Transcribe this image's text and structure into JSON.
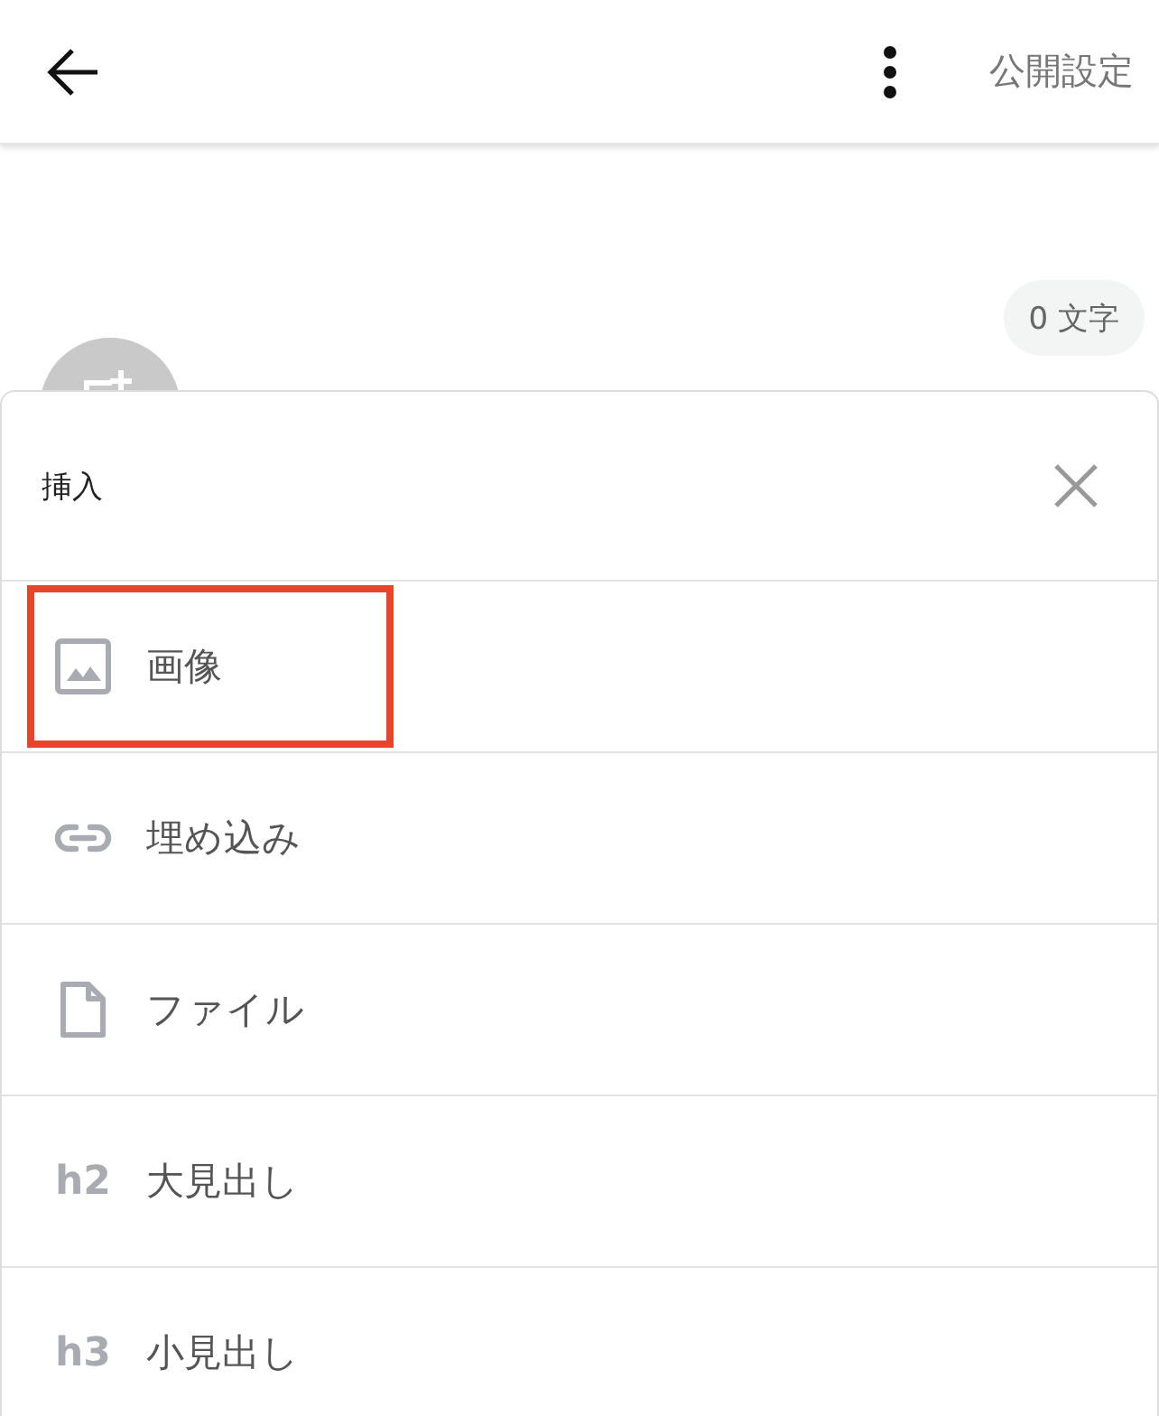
{
  "header": {
    "publish_label": "公開設定"
  },
  "word_count": "0 文字",
  "insert_sheet": {
    "title": "挿入",
    "items": [
      {
        "kind": "image",
        "label": "画像",
        "highlighted": true
      },
      {
        "kind": "embed",
        "label": "埋め込み",
        "highlighted": false
      },
      {
        "kind": "file",
        "label": "ファイル",
        "highlighted": false
      },
      {
        "kind": "heading",
        "marker": "h2",
        "label": "大見出し",
        "highlighted": false
      },
      {
        "kind": "heading",
        "marker": "h3",
        "label": "小見出し",
        "highlighted": false
      }
    ]
  }
}
